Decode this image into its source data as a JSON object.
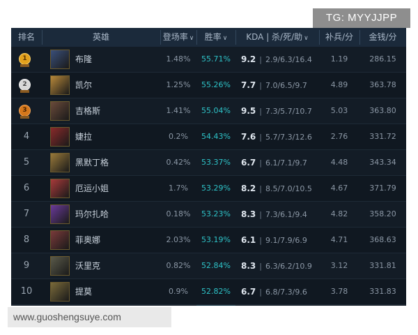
{
  "watermark_top": "TG: MYYJJPP",
  "watermark_bottom": "www.guoshengsuye.com",
  "header": {
    "rank": "排名",
    "hero": "英雄",
    "pick_rate": "登场率",
    "win_rate": "胜率",
    "kda": "KDA | 杀/死/助",
    "cs": "补兵/分",
    "gold": "金钱/分"
  },
  "rows": [
    {
      "rank": "1",
      "medal": "1",
      "hero": "布隆",
      "pick": "1.48%",
      "win": "55.71%",
      "kda": "9.2",
      "kda_detail": "2.9/6.3/16.4",
      "cs": "1.19",
      "gold": "286.15",
      "avatar_color": "#3a4f7a"
    },
    {
      "rank": "2",
      "medal": "2",
      "hero": "凯尔",
      "pick": "1.25%",
      "win": "55.26%",
      "kda": "7.7",
      "kda_detail": "7.0/6.5/9.7",
      "cs": "4.89",
      "gold": "363.78",
      "avatar_color": "#b8893a"
    },
    {
      "rank": "3",
      "medal": "3",
      "hero": "吉格斯",
      "pick": "1.41%",
      "win": "55.04%",
      "kda": "9.5",
      "kda_detail": "7.3/5.7/10.7",
      "cs": "5.03",
      "gold": "363.80",
      "avatar_color": "#6a4a3a"
    },
    {
      "rank": "4",
      "medal": "",
      "hero": "婕拉",
      "pick": "0.2%",
      "win": "54.43%",
      "kda": "7.6",
      "kda_detail": "5.7/7.3/12.6",
      "cs": "2.76",
      "gold": "331.72",
      "avatar_color": "#8a2a2a"
    },
    {
      "rank": "5",
      "medal": "",
      "hero": "黑默丁格",
      "pick": "0.42%",
      "win": "53.37%",
      "kda": "6.7",
      "kda_detail": "6.1/7.1/9.7",
      "cs": "4.48",
      "gold": "343.34",
      "avatar_color": "#9a7a3a"
    },
    {
      "rank": "6",
      "medal": "",
      "hero": "厄运小姐",
      "pick": "1.7%",
      "win": "53.29%",
      "kda": "8.2",
      "kda_detail": "8.5/7.0/10.5",
      "cs": "4.67",
      "gold": "371.79",
      "avatar_color": "#a83a3a"
    },
    {
      "rank": "7",
      "medal": "",
      "hero": "玛尔扎哈",
      "pick": "0.18%",
      "win": "53.23%",
      "kda": "8.3",
      "kda_detail": "7.3/6.1/9.4",
      "cs": "4.82",
      "gold": "358.20",
      "avatar_color": "#6a3a9a"
    },
    {
      "rank": "8",
      "medal": "",
      "hero": "菲奥娜",
      "pick": "2.03%",
      "win": "53.19%",
      "kda": "6.1",
      "kda_detail": "9.1/7.9/6.9",
      "cs": "4.71",
      "gold": "368.63",
      "avatar_color": "#7a3a3a"
    },
    {
      "rank": "9",
      "medal": "",
      "hero": "沃里克",
      "pick": "0.82%",
      "win": "52.84%",
      "kda": "8.3",
      "kda_detail": "6.3/6.2/10.9",
      "cs": "3.12",
      "gold": "331.81",
      "avatar_color": "#5a5a4a"
    },
    {
      "rank": "10",
      "medal": "",
      "hero": "提莫",
      "pick": "0.9%",
      "win": "52.82%",
      "kda": "6.7",
      "kda_detail": "6.8/7.3/9.6",
      "cs": "3.78",
      "gold": "331.83",
      "avatar_color": "#7a6a3a"
    }
  ]
}
